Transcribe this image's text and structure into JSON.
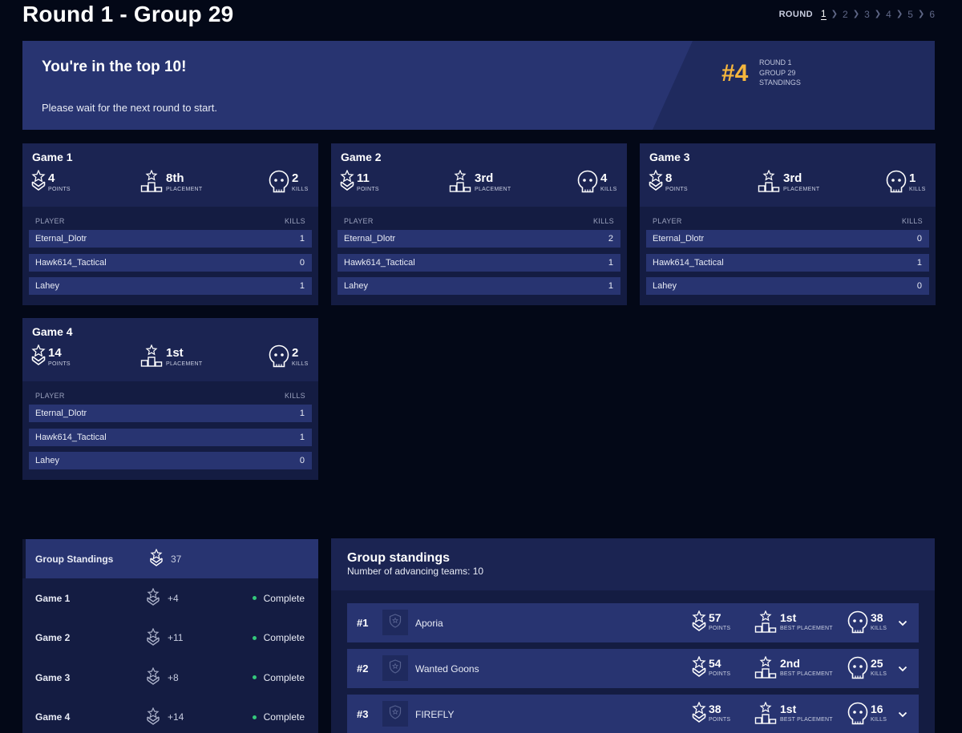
{
  "header": {
    "title": "Round 1 - Group 29",
    "round_label": "ROUND",
    "rounds": [
      "1",
      "2",
      "3",
      "4",
      "5",
      "6"
    ],
    "active_round": "1"
  },
  "banner": {
    "title": "You're in the top 10!",
    "subtitle": "Please wait for the next round to start.",
    "rank": "#4",
    "meta": [
      "ROUND 1",
      "GROUP 29",
      "STANDINGS"
    ],
    "rank_color": "#f5b63d"
  },
  "labels": {
    "points": "POINTS",
    "placement": "PLACEMENT",
    "kills": "KILLS",
    "player": "PLAYER",
    "best_placement": "BEST PLACEMENT"
  },
  "games": [
    {
      "title": "Game 1",
      "points": "4",
      "placement": "8th",
      "kills": "2",
      "players": [
        {
          "name": "Eternal_Dlotr",
          "kills": "1"
        },
        {
          "name": "Hawk614_Tactical",
          "kills": "0"
        },
        {
          "name": "Lahey",
          "kills": "1"
        }
      ]
    },
    {
      "title": "Game 2",
      "points": "11",
      "placement": "3rd",
      "kills": "4",
      "players": [
        {
          "name": "Eternal_Dlotr",
          "kills": "2"
        },
        {
          "name": "Hawk614_Tactical",
          "kills": "1"
        },
        {
          "name": "Lahey",
          "kills": "1"
        }
      ]
    },
    {
      "title": "Game 3",
      "points": "8",
      "placement": "3rd",
      "kills": "1",
      "players": [
        {
          "name": "Eternal_Dlotr",
          "kills": "0"
        },
        {
          "name": "Hawk614_Tactical",
          "kills": "1"
        },
        {
          "name": "Lahey",
          "kills": "0"
        }
      ]
    },
    {
      "title": "Game 4",
      "points": "14",
      "placement": "1st",
      "kills": "2",
      "players": [
        {
          "name": "Eternal_Dlotr",
          "kills": "1"
        },
        {
          "name": "Hawk614_Tactical",
          "kills": "1"
        },
        {
          "name": "Lahey",
          "kills": "0"
        }
      ]
    }
  ],
  "group_panel": {
    "title": "Group Standings",
    "total": "37",
    "games": [
      {
        "name": "Game 1",
        "points": "+4",
        "status": "Complete"
      },
      {
        "name": "Game 2",
        "points": "+11",
        "status": "Complete"
      },
      {
        "name": "Game 3",
        "points": "+8",
        "status": "Complete"
      },
      {
        "name": "Game 4",
        "points": "+14",
        "status": "Complete"
      }
    ],
    "status_color": "#34c77b"
  },
  "standings": {
    "title": "Group standings",
    "subtitle": "Number of advancing teams: 10",
    "teams": [
      {
        "rank": "#1",
        "name": "Aporia",
        "points": "57",
        "best_placement": "1st",
        "kills": "38"
      },
      {
        "rank": "#2",
        "name": "Wanted Goons",
        "points": "54",
        "best_placement": "2nd",
        "kills": "25"
      },
      {
        "rank": "#3",
        "name": "FIREFLY",
        "points": "38",
        "best_placement": "1st",
        "kills": "16"
      }
    ]
  }
}
